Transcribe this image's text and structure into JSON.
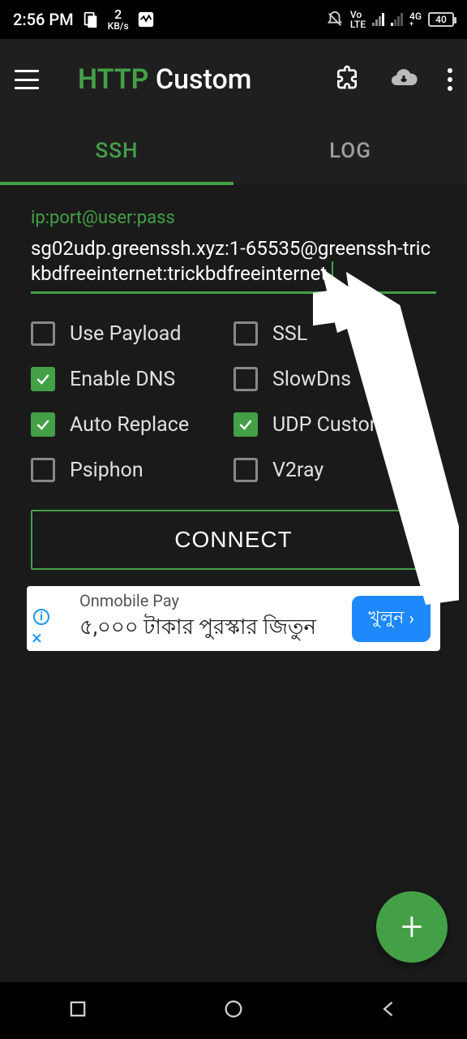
{
  "status": {
    "time": "2:56 PM",
    "kbs_value": "2",
    "kbs_unit": "KB/s",
    "vo": "Vo",
    "lte": "LTE",
    "net": "4G",
    "battery": "40"
  },
  "header": {
    "title_a": "HTTP",
    "title_b": " Custom"
  },
  "tabs": {
    "ssh": "SSH",
    "log": "LOG",
    "active": "ssh"
  },
  "form": {
    "label": "ip:port@user:pass",
    "value": "sg02udp.greenssh.xyz:1-65535@greenssh-trickbdfreeinternet:trickbdfreeinternet"
  },
  "checks": {
    "use_payload": {
      "label": "Use Payload",
      "checked": false
    },
    "ssl": {
      "label": "SSL",
      "checked": false
    },
    "enable_dns": {
      "label": "Enable DNS",
      "checked": true
    },
    "slowdns": {
      "label": "SlowDns",
      "checked": false
    },
    "auto_replace": {
      "label": "Auto Replace",
      "checked": true
    },
    "udp_custom": {
      "label": "UDP Custom",
      "checked": true
    },
    "psiphon": {
      "label": "Psiphon",
      "checked": false
    },
    "v2ray": {
      "label": "V2ray",
      "checked": false
    }
  },
  "connect_label": "CONNECT",
  "ad": {
    "title": "Onmobile Pay",
    "subtitle": "৫,০০০ টাকার পুরস্কার জিতুন",
    "cta": "খুলুন"
  },
  "fab": "+"
}
